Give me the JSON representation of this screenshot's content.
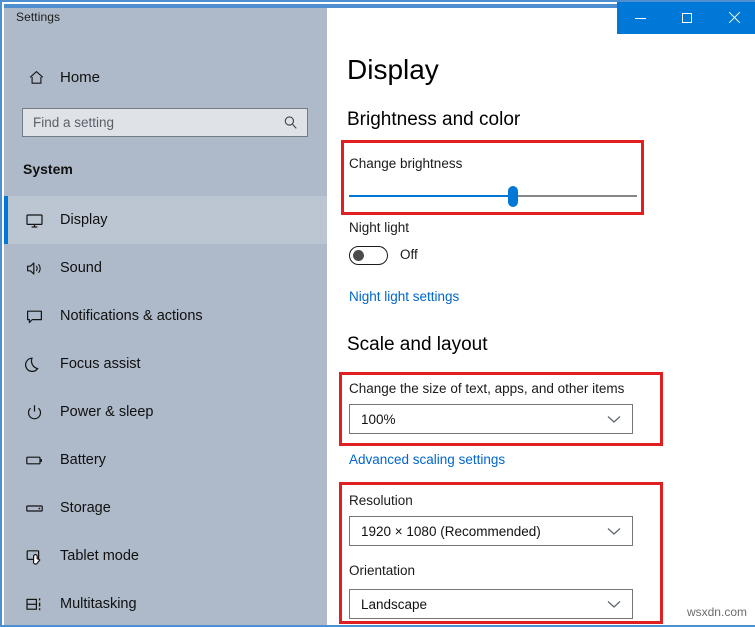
{
  "window": {
    "title": "Settings",
    "accent_color": "#0078d7",
    "sidebar_color": "#aebac9",
    "highlight_color": "#e02020",
    "controls": {
      "minimize": "minimize-button",
      "maximize": "maximize-button",
      "close": "close-button"
    }
  },
  "sidebar": {
    "home_label": "Home",
    "home_icon": "home-icon",
    "search": {
      "placeholder": "Find a setting",
      "value": "",
      "icon": "search-icon"
    },
    "section_title": "System",
    "items": [
      {
        "label": "Display",
        "icon": "monitor-icon",
        "selected": true
      },
      {
        "label": "Sound",
        "icon": "speaker-icon",
        "selected": false
      },
      {
        "label": "Notifications & actions",
        "icon": "notification-icon",
        "selected": false
      },
      {
        "label": "Focus assist",
        "icon": "moon-icon",
        "selected": false
      },
      {
        "label": "Power & sleep",
        "icon": "power-icon",
        "selected": false
      },
      {
        "label": "Battery",
        "icon": "battery-icon",
        "selected": false
      },
      {
        "label": "Storage",
        "icon": "storage-icon",
        "selected": false
      },
      {
        "label": "Tablet mode",
        "icon": "tablet-icon",
        "selected": false
      },
      {
        "label": "Multitasking",
        "icon": "multitasking-icon",
        "selected": false
      }
    ]
  },
  "main": {
    "page_title": "Display",
    "brightness_section": {
      "heading": "Brightness and color",
      "slider_label": "Change brightness",
      "slider_value": 57,
      "slider_min": 0,
      "slider_max": 100,
      "night_light_label": "Night light",
      "night_light_state": "Off",
      "night_light_on": false,
      "night_light_settings_link": "Night light settings"
    },
    "scale_section": {
      "heading": "Scale and layout",
      "scale_label": "Change the size of text, apps, and other items",
      "scale_value": "100%",
      "advanced_scaling_link": "Advanced scaling settings",
      "resolution_label": "Resolution",
      "resolution_value": "1920 × 1080 (Recommended)",
      "orientation_label": "Orientation",
      "orientation_value": "Landscape"
    }
  },
  "watermark": "wsxdn.com"
}
